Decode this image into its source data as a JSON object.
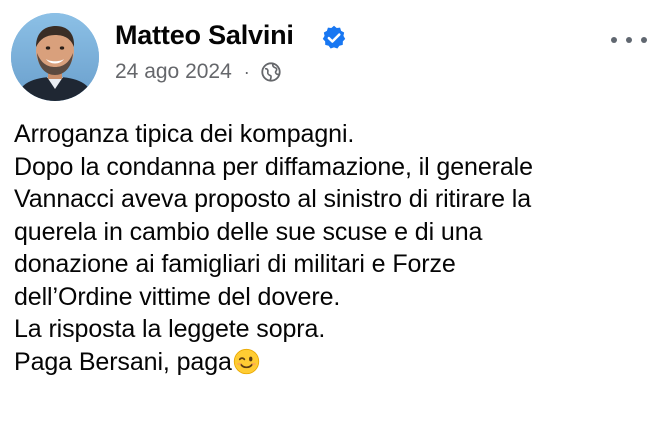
{
  "post": {
    "author": "Matteo Salvini",
    "date": "24 ago 2024",
    "separator": "·",
    "lines": [
      "Arroganza tipica dei kompagni.",
      "Dopo la condanna per diffamazione, il generale",
      "Vannacci aveva proposto al sinistro di ritirare la",
      "querela in cambio delle sue scuse e di una",
      "donazione ai famigliari di militari e Forze",
      "dell’Ordine vittime del dovere.",
      "La risposta la leggete sopra.",
      "Paga Bersani, paga"
    ]
  },
  "icons": {
    "verified": "verified-badge-icon",
    "audience": "globe-icon",
    "more": "more-options-icon",
    "emoji": "winking-face-emoji"
  },
  "colors": {
    "text": "#050505",
    "secondary_text": "#65676b",
    "verified_blue": "#1877f2",
    "background": "#ffffff"
  }
}
